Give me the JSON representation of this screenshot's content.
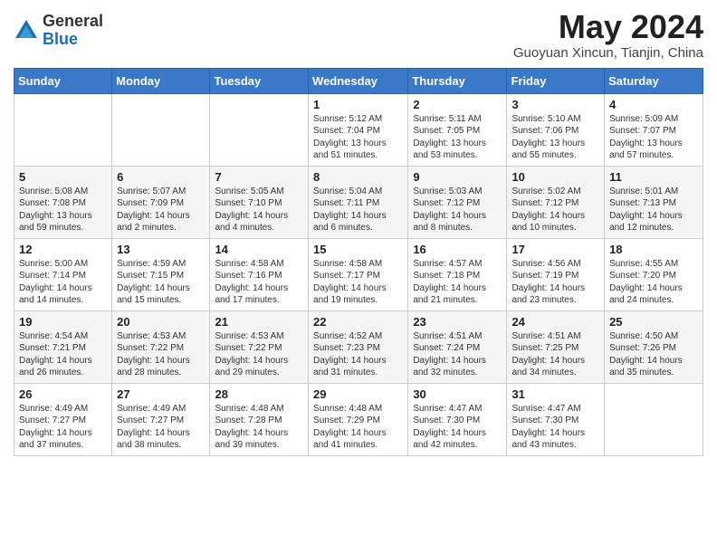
{
  "header": {
    "logo_general": "General",
    "logo_blue": "Blue",
    "month_title": "May 2024",
    "location": "Guoyuan Xincun, Tianjin, China"
  },
  "days_of_week": [
    "Sunday",
    "Monday",
    "Tuesday",
    "Wednesday",
    "Thursday",
    "Friday",
    "Saturday"
  ],
  "weeks": [
    [
      {
        "day": "",
        "sunrise": "",
        "sunset": "",
        "daylight": ""
      },
      {
        "day": "",
        "sunrise": "",
        "sunset": "",
        "daylight": ""
      },
      {
        "day": "",
        "sunrise": "",
        "sunset": "",
        "daylight": ""
      },
      {
        "day": "1",
        "sunrise": "Sunrise: 5:12 AM",
        "sunset": "Sunset: 7:04 PM",
        "daylight": "Daylight: 13 hours and 51 minutes."
      },
      {
        "day": "2",
        "sunrise": "Sunrise: 5:11 AM",
        "sunset": "Sunset: 7:05 PM",
        "daylight": "Daylight: 13 hours and 53 minutes."
      },
      {
        "day": "3",
        "sunrise": "Sunrise: 5:10 AM",
        "sunset": "Sunset: 7:06 PM",
        "daylight": "Daylight: 13 hours and 55 minutes."
      },
      {
        "day": "4",
        "sunrise": "Sunrise: 5:09 AM",
        "sunset": "Sunset: 7:07 PM",
        "daylight": "Daylight: 13 hours and 57 minutes."
      }
    ],
    [
      {
        "day": "5",
        "sunrise": "Sunrise: 5:08 AM",
        "sunset": "Sunset: 7:08 PM",
        "daylight": "Daylight: 13 hours and 59 minutes."
      },
      {
        "day": "6",
        "sunrise": "Sunrise: 5:07 AM",
        "sunset": "Sunset: 7:09 PM",
        "daylight": "Daylight: 14 hours and 2 minutes."
      },
      {
        "day": "7",
        "sunrise": "Sunrise: 5:05 AM",
        "sunset": "Sunset: 7:10 PM",
        "daylight": "Daylight: 14 hours and 4 minutes."
      },
      {
        "day": "8",
        "sunrise": "Sunrise: 5:04 AM",
        "sunset": "Sunset: 7:11 PM",
        "daylight": "Daylight: 14 hours and 6 minutes."
      },
      {
        "day": "9",
        "sunrise": "Sunrise: 5:03 AM",
        "sunset": "Sunset: 7:12 PM",
        "daylight": "Daylight: 14 hours and 8 minutes."
      },
      {
        "day": "10",
        "sunrise": "Sunrise: 5:02 AM",
        "sunset": "Sunset: 7:12 PM",
        "daylight": "Daylight: 14 hours and 10 minutes."
      },
      {
        "day": "11",
        "sunrise": "Sunrise: 5:01 AM",
        "sunset": "Sunset: 7:13 PM",
        "daylight": "Daylight: 14 hours and 12 minutes."
      }
    ],
    [
      {
        "day": "12",
        "sunrise": "Sunrise: 5:00 AM",
        "sunset": "Sunset: 7:14 PM",
        "daylight": "Daylight: 14 hours and 14 minutes."
      },
      {
        "day": "13",
        "sunrise": "Sunrise: 4:59 AM",
        "sunset": "Sunset: 7:15 PM",
        "daylight": "Daylight: 14 hours and 15 minutes."
      },
      {
        "day": "14",
        "sunrise": "Sunrise: 4:58 AM",
        "sunset": "Sunset: 7:16 PM",
        "daylight": "Daylight: 14 hours and 17 minutes."
      },
      {
        "day": "15",
        "sunrise": "Sunrise: 4:58 AM",
        "sunset": "Sunset: 7:17 PM",
        "daylight": "Daylight: 14 hours and 19 minutes."
      },
      {
        "day": "16",
        "sunrise": "Sunrise: 4:57 AM",
        "sunset": "Sunset: 7:18 PM",
        "daylight": "Daylight: 14 hours and 21 minutes."
      },
      {
        "day": "17",
        "sunrise": "Sunrise: 4:56 AM",
        "sunset": "Sunset: 7:19 PM",
        "daylight": "Daylight: 14 hours and 23 minutes."
      },
      {
        "day": "18",
        "sunrise": "Sunrise: 4:55 AM",
        "sunset": "Sunset: 7:20 PM",
        "daylight": "Daylight: 14 hours and 24 minutes."
      }
    ],
    [
      {
        "day": "19",
        "sunrise": "Sunrise: 4:54 AM",
        "sunset": "Sunset: 7:21 PM",
        "daylight": "Daylight: 14 hours and 26 minutes."
      },
      {
        "day": "20",
        "sunrise": "Sunrise: 4:53 AM",
        "sunset": "Sunset: 7:22 PM",
        "daylight": "Daylight: 14 hours and 28 minutes."
      },
      {
        "day": "21",
        "sunrise": "Sunrise: 4:53 AM",
        "sunset": "Sunset: 7:22 PM",
        "daylight": "Daylight: 14 hours and 29 minutes."
      },
      {
        "day": "22",
        "sunrise": "Sunrise: 4:52 AM",
        "sunset": "Sunset: 7:23 PM",
        "daylight": "Daylight: 14 hours and 31 minutes."
      },
      {
        "day": "23",
        "sunrise": "Sunrise: 4:51 AM",
        "sunset": "Sunset: 7:24 PM",
        "daylight": "Daylight: 14 hours and 32 minutes."
      },
      {
        "day": "24",
        "sunrise": "Sunrise: 4:51 AM",
        "sunset": "Sunset: 7:25 PM",
        "daylight": "Daylight: 14 hours and 34 minutes."
      },
      {
        "day": "25",
        "sunrise": "Sunrise: 4:50 AM",
        "sunset": "Sunset: 7:26 PM",
        "daylight": "Daylight: 14 hours and 35 minutes."
      }
    ],
    [
      {
        "day": "26",
        "sunrise": "Sunrise: 4:49 AM",
        "sunset": "Sunset: 7:27 PM",
        "daylight": "Daylight: 14 hours and 37 minutes."
      },
      {
        "day": "27",
        "sunrise": "Sunrise: 4:49 AM",
        "sunset": "Sunset: 7:27 PM",
        "daylight": "Daylight: 14 hours and 38 minutes."
      },
      {
        "day": "28",
        "sunrise": "Sunrise: 4:48 AM",
        "sunset": "Sunset: 7:28 PM",
        "daylight": "Daylight: 14 hours and 39 minutes."
      },
      {
        "day": "29",
        "sunrise": "Sunrise: 4:48 AM",
        "sunset": "Sunset: 7:29 PM",
        "daylight": "Daylight: 14 hours and 41 minutes."
      },
      {
        "day": "30",
        "sunrise": "Sunrise: 4:47 AM",
        "sunset": "Sunset: 7:30 PM",
        "daylight": "Daylight: 14 hours and 42 minutes."
      },
      {
        "day": "31",
        "sunrise": "Sunrise: 4:47 AM",
        "sunset": "Sunset: 7:30 PM",
        "daylight": "Daylight: 14 hours and 43 minutes."
      },
      {
        "day": "",
        "sunrise": "",
        "sunset": "",
        "daylight": ""
      }
    ]
  ]
}
